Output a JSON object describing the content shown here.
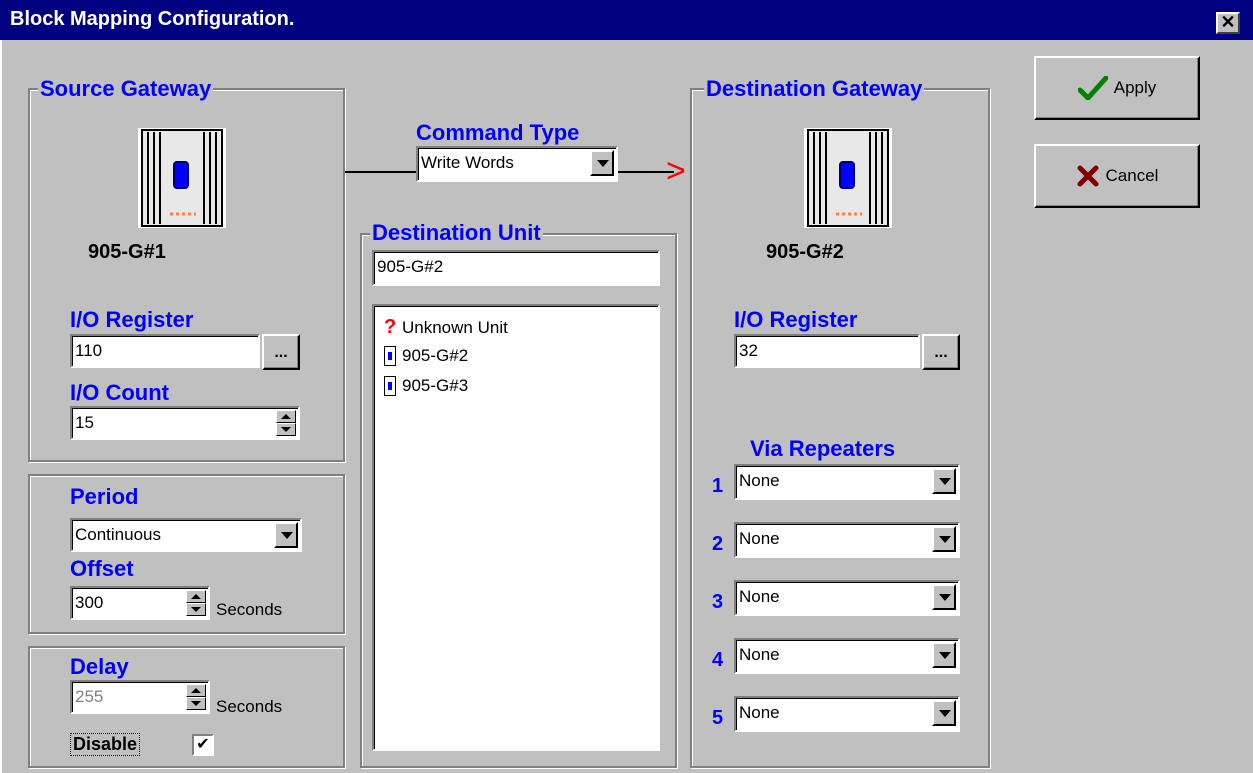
{
  "window": {
    "title": "Block Mapping Configuration.",
    "close_glyph": "✕"
  },
  "source": {
    "legend": "Source Gateway",
    "unit_name": "905-G#1",
    "io_register_label": "I/O Register",
    "io_register_value": "110",
    "io_count_label": "I/O Count",
    "io_count_value": "15",
    "browse_label": "..."
  },
  "timing": {
    "period_label": "Period",
    "period_value": "Continuous",
    "offset_label": "Offset",
    "offset_value": "300",
    "offset_unit": "Seconds",
    "delay_label": "Delay",
    "delay_value": "255",
    "delay_unit": "Seconds",
    "disable_label": "Disable",
    "disable_checked": true,
    "check_glyph": "✔"
  },
  "command": {
    "label": "Command Type",
    "value": "Write Words",
    "arrow_glyph": ">"
  },
  "destination_unit": {
    "legend": "Destination Unit",
    "value": "905-G#2",
    "list": [
      {
        "label": "Unknown Unit",
        "icon": "question-icon"
      },
      {
        "label": "905-G#2",
        "icon": "unit-icon"
      },
      {
        "label": "905-G#3",
        "icon": "unit-icon"
      }
    ],
    "question_glyph": "?"
  },
  "destination": {
    "legend": "Destination Gateway",
    "unit_name": "905-G#2",
    "io_register_label": "I/O Register",
    "io_register_value": "32",
    "browse_label": "...",
    "via_label": "Via Repeaters",
    "repeaters": [
      {
        "num": "1",
        "value": "None"
      },
      {
        "num": "2",
        "value": "None"
      },
      {
        "num": "3",
        "value": "None"
      },
      {
        "num": "4",
        "value": "None"
      },
      {
        "num": "5",
        "value": "None"
      }
    ]
  },
  "buttons": {
    "apply": "Apply",
    "cancel": "Cancel"
  },
  "colors": {
    "title_bar": "#000080",
    "label_blue": "#0000ff",
    "face": "#c0c0c0",
    "arrow_red": "#ff0000",
    "apply_check": "#008000",
    "cancel_x": "#800000"
  }
}
